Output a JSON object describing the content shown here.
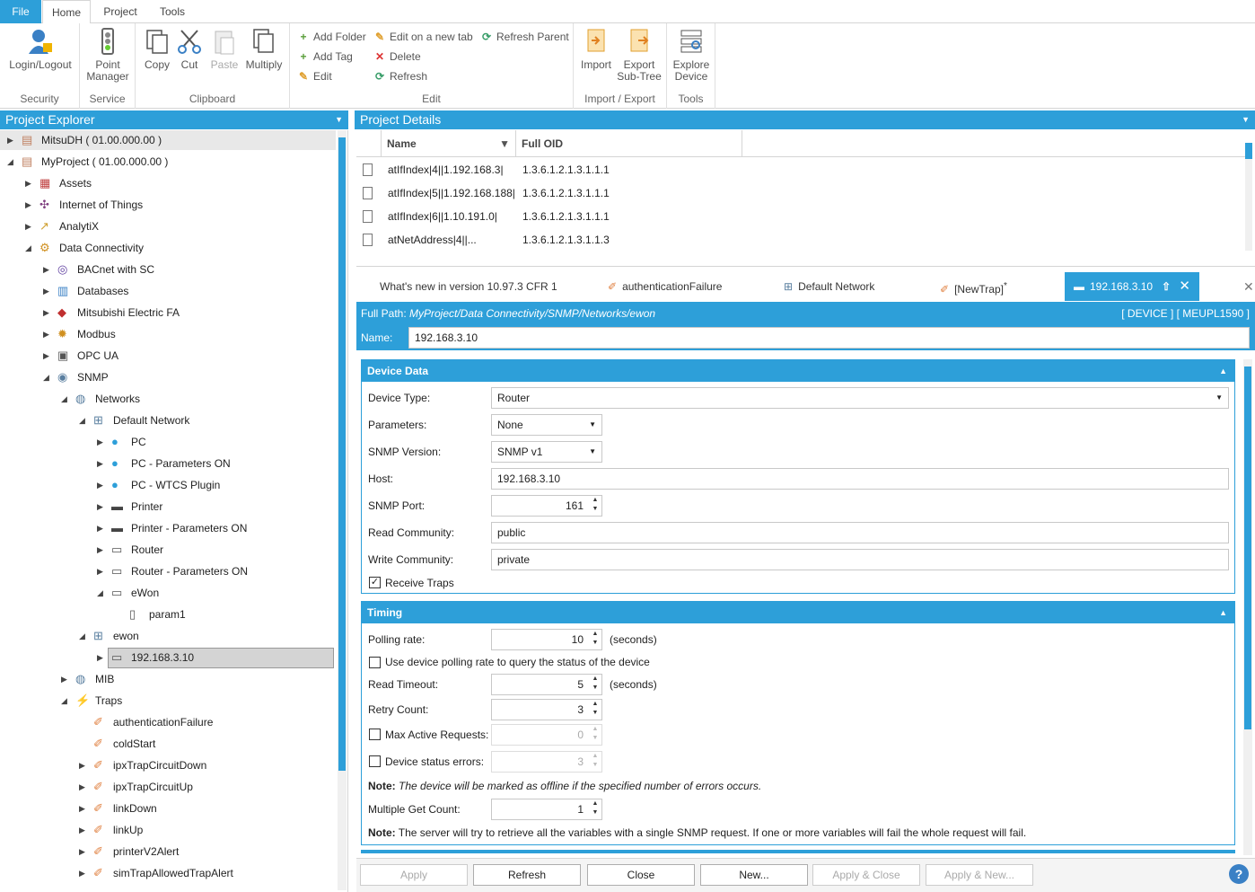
{
  "menubar": {
    "items": [
      "File",
      "Home",
      "Project",
      "Tools"
    ]
  },
  "ribbon": {
    "groups": {
      "security": {
        "label": "Security",
        "login": "Login/Logout"
      },
      "service": {
        "label": "Service",
        "point_manager": "Point Manager"
      },
      "clipboard": {
        "label": "Clipboard",
        "copy": "Copy",
        "cut": "Cut",
        "paste": "Paste",
        "multiply": "Multiply"
      },
      "edit": {
        "label": "Edit",
        "add_folder": "Add Folder",
        "add_tag": "Add Tag",
        "edit": "Edit",
        "edit_new_tab": "Edit on a new tab",
        "delete": "Delete",
        "refresh": "Refresh",
        "refresh_parent": "Refresh Parent"
      },
      "import_export": {
        "label": "Import / Export",
        "import": "Import",
        "export": "Export Sub-Tree"
      },
      "tools": {
        "label": "Tools",
        "explore_device": "Explore Device"
      }
    }
  },
  "explorer": {
    "title": "Project Explorer",
    "nodes": [
      {
        "label": "MitsuDH ( 01.00.000.00 )"
      },
      {
        "label": "MyProject ( 01.00.000.00 )"
      },
      {
        "label": "Assets"
      },
      {
        "label": "Internet of Things"
      },
      {
        "label": "AnalytiX"
      },
      {
        "label": "Data Connectivity"
      },
      {
        "label": "BACnet with SC"
      },
      {
        "label": "Databases"
      },
      {
        "label": "Mitsubishi Electric FA"
      },
      {
        "label": "Modbus"
      },
      {
        "label": "OPC UA"
      },
      {
        "label": "SNMP"
      },
      {
        "label": "Networks"
      },
      {
        "label": "Default Network"
      },
      {
        "label": "PC"
      },
      {
        "label": "PC - Parameters ON"
      },
      {
        "label": "PC - WTCS Plugin"
      },
      {
        "label": "Printer"
      },
      {
        "label": "Printer - Parameters ON"
      },
      {
        "label": "Router"
      },
      {
        "label": "Router - Parameters ON"
      },
      {
        "label": "eWon"
      },
      {
        "label": "param1"
      },
      {
        "label": "ewon"
      },
      {
        "label": "192.168.3.10"
      },
      {
        "label": "MIB"
      },
      {
        "label": "Traps"
      },
      {
        "label": "authenticationFailure"
      },
      {
        "label": "coldStart"
      },
      {
        "label": "ipxTrapCircuitDown"
      },
      {
        "label": "ipxTrapCircuitUp"
      },
      {
        "label": "linkDown"
      },
      {
        "label": "linkUp"
      },
      {
        "label": "printerV2Alert"
      },
      {
        "label": "simTrapAllowedTrapAlert"
      }
    ]
  },
  "details": {
    "title": "Project Details",
    "columns": {
      "name": "Name",
      "oid": "Full OID"
    },
    "rows": [
      {
        "name": "atIfIndex|4||1.192.168.3|",
        "oid": "1.3.6.1.2.1.3.1.1.1"
      },
      {
        "name": "atIfIndex|5||1.192.168.188|",
        "oid": "1.3.6.1.2.1.3.1.1.1"
      },
      {
        "name": "atIfIndex|6||1.10.191.0|",
        "oid": "1.3.6.1.2.1.3.1.1.1"
      },
      {
        "name": "atNetAddress|4||...",
        "oid": "1.3.6.1.2.1.3.1.1.3"
      }
    ]
  },
  "tabs": {
    "whats_new": "What's new in version 10.97.3 CFR 1",
    "auth": "authenticationFailure",
    "default_network": "Default Network",
    "new_trap": "[NewTrap]",
    "new_trap_mark": "*",
    "active": "192.168.3.10"
  },
  "path": {
    "label": "Full Path:",
    "value": "MyProject/Data Connectivity/SNMP/Networks/ewon",
    "right": "[ DEVICE ] [ MEUPL1590 ]",
    "name_label": "Name:",
    "name_value": "192.168.3.10"
  },
  "device_data": {
    "title": "Device Data",
    "device_type_label": "Device Type:",
    "device_type": "Router",
    "parameters_label": "Parameters:",
    "parameters": "None",
    "snmp_version_label": "SNMP Version:",
    "snmp_version": "SNMP v1",
    "host_label": "Host:",
    "host": "192.168.3.10",
    "port_label": "SNMP Port:",
    "port": "161",
    "read_label": "Read Community:",
    "read": "public",
    "write_label": "Write Community:",
    "write": "private",
    "receive_traps_label": "Receive Traps",
    "receive_traps": true
  },
  "timing": {
    "title": "Timing",
    "polling_label": "Polling rate:",
    "polling": "10",
    "seconds": "(seconds)",
    "use_device_label": "Use device polling rate to query the status of the device",
    "read_timeout_label": "Read Timeout:",
    "read_timeout": "5",
    "retry_label": "Retry Count:",
    "retry": "3",
    "max_active_label": "Max Active Requests:",
    "max_active": "0",
    "status_errors_label": "Device status errors:",
    "status_errors": "3",
    "note1_bold": "Note:",
    "note1": " The device will be marked as offline if the specified number of errors occurs.",
    "multi_get_label": "Multiple Get Count:",
    "multi_get": "1",
    "note2_bold": "Note:",
    "note2": " The server will try to retrieve all the variables with a single SNMP request. If one or more variables will fail the whole request will fail."
  },
  "buttons": {
    "apply": "Apply",
    "refresh": "Refresh",
    "close": "Close",
    "new": "New...",
    "apply_close": "Apply & Close",
    "apply_new": "Apply & New..."
  },
  "colors": {
    "accent": "#2d9fd9"
  }
}
